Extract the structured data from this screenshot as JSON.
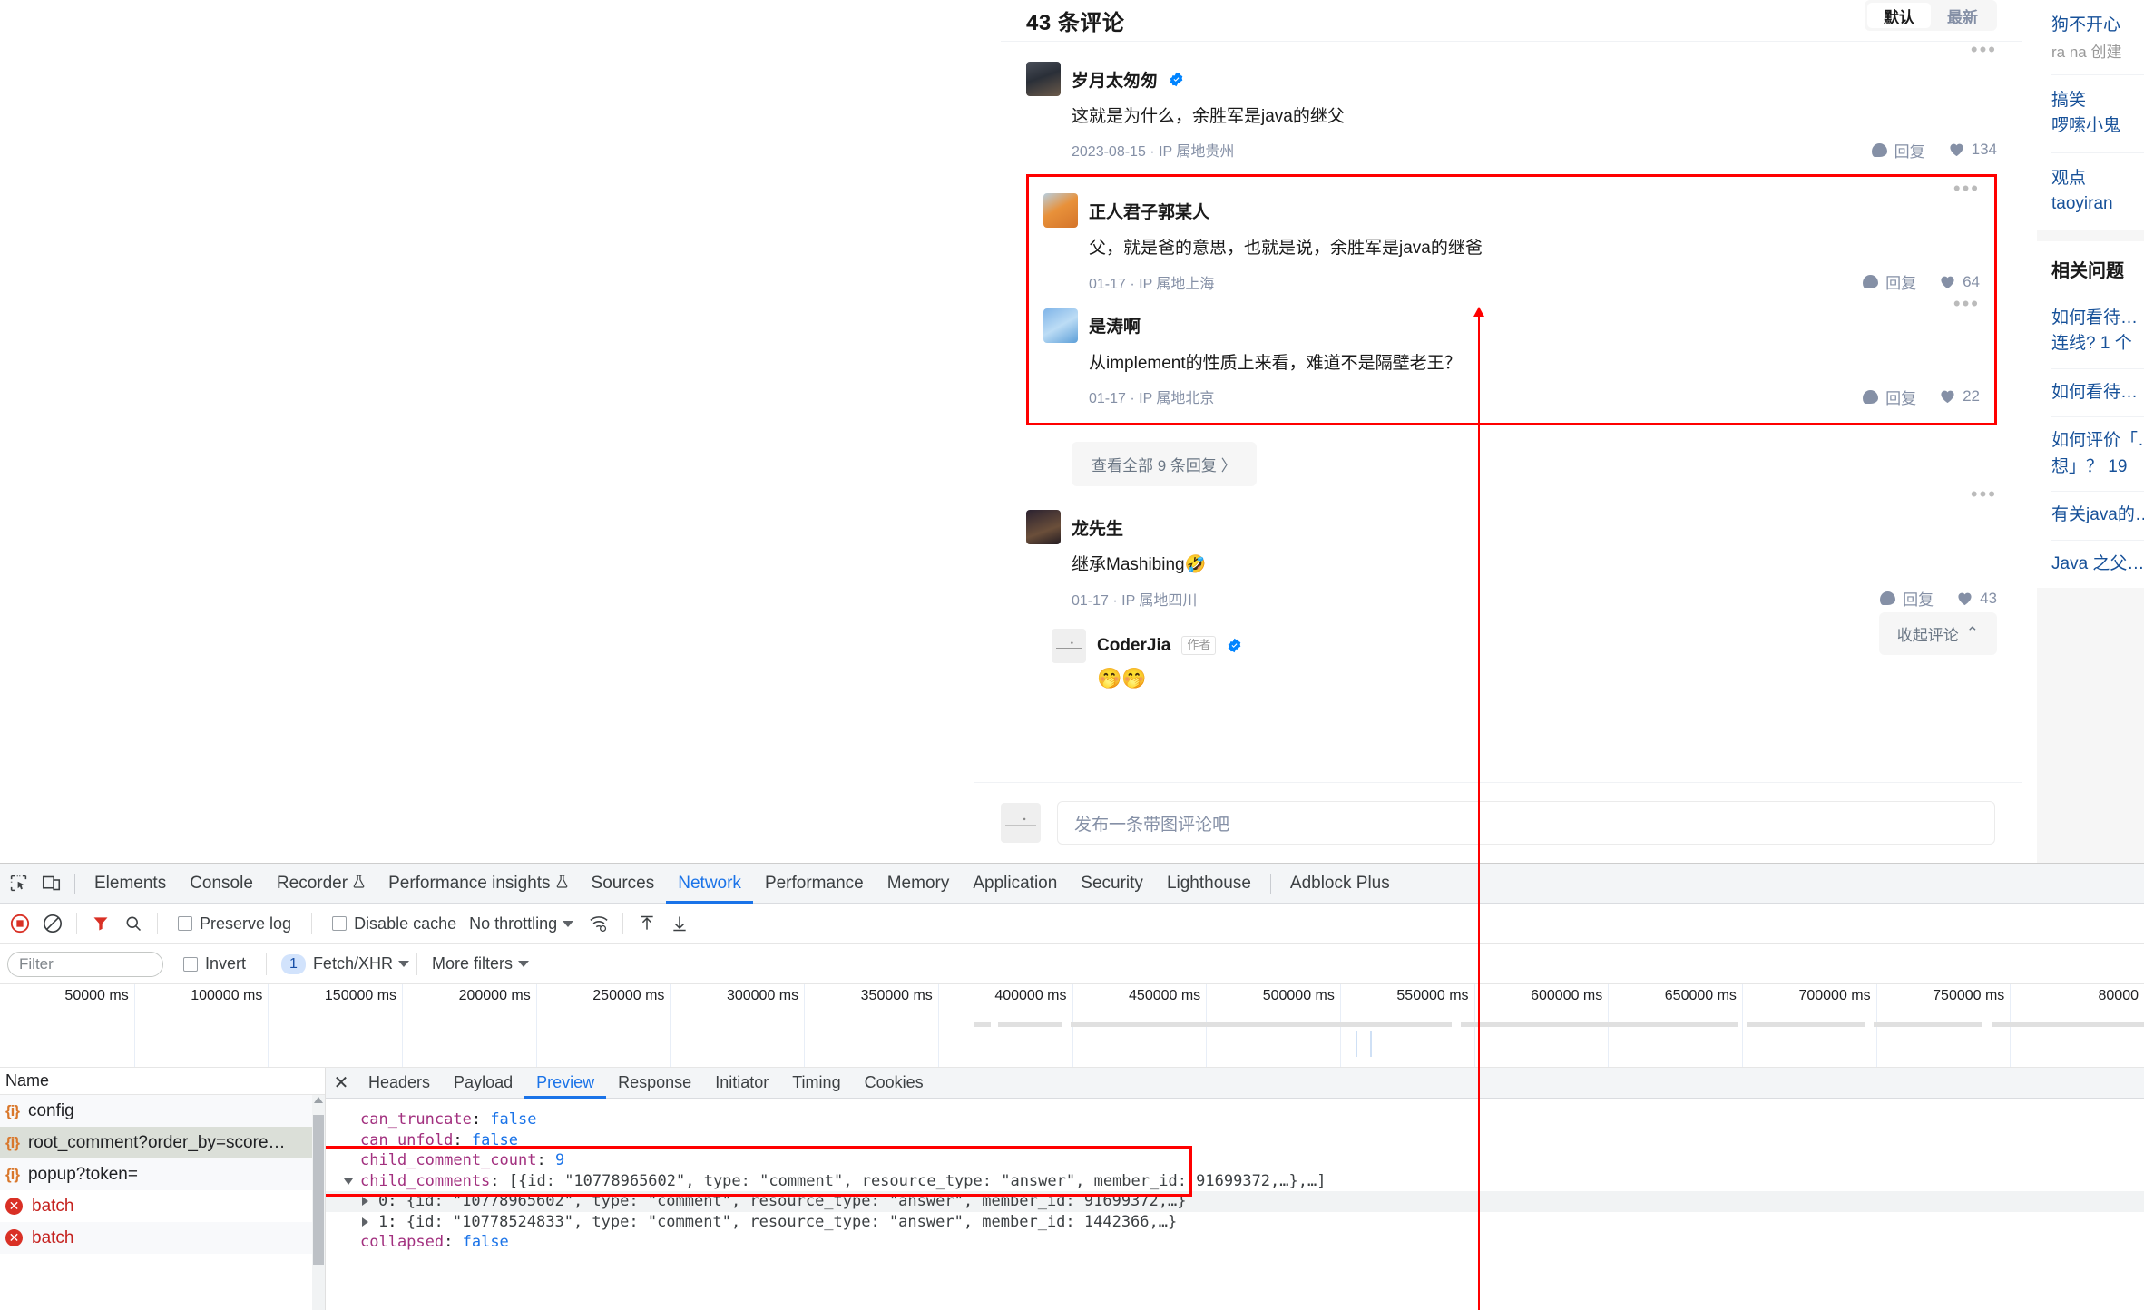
{
  "page": {
    "comment_count_label": "43 条评论",
    "sort": {
      "default_label": "默认",
      "latest_label": "最新"
    },
    "comments": [
      {
        "name": "岁月太匆匆",
        "verified": true,
        "text": "这就是为什么，余胜军是java的继父",
        "meta": "2023-08-15 · IP 属地贵州",
        "reply_label": "回复",
        "likes": "134"
      },
      {
        "name": "正人君子郭某人",
        "verified": false,
        "text": "父，就是爸的意思，也就是说，余胜军是java的继爸",
        "meta": "01-17 · IP 属地上海",
        "reply_label": "回复",
        "likes": "64"
      },
      {
        "name": "是涛啊",
        "verified": false,
        "text": "从implement的性质上来看，难道不是隔壁老王？",
        "meta": "01-17 · IP 属地北京",
        "reply_label": "回复",
        "likes": "22"
      },
      {
        "name": "龙先生",
        "verified": false,
        "text": "继承Mashibing🤣",
        "meta": "01-17 · IP 属地四川",
        "reply_label": "回复",
        "likes": "43"
      }
    ],
    "view_all_replies": "查看全部 9 条回复 〉",
    "author_comment": {
      "name": "CoderJia",
      "author_tag": "作者",
      "verified": true,
      "text": "🤭🤭"
    },
    "collapse_label": "收起评论",
    "composer_placeholder": "发布一条带图评论吧"
  },
  "right_rail": {
    "items": [
      {
        "title": "狗不开心",
        "sub": "ra na 创建"
      },
      {
        "title": "搞笑",
        "sub": "啰嗦小鬼"
      },
      {
        "title": "观点",
        "sub": "taoyiran"
      }
    ],
    "related_title": "相关问题",
    "related": [
      "如何看待…",
      "连线? 1 个",
      "如何看待…",
      "如何评价「…",
      "想」？ 19",
      "有关java的…",
      "Java 之父…"
    ]
  },
  "devtools": {
    "tabs": [
      {
        "label": "Elements",
        "active": false
      },
      {
        "label": "Console",
        "active": false
      },
      {
        "label": "Recorder",
        "active": false,
        "flask": true
      },
      {
        "label": "Performance insights",
        "active": false,
        "flask": true
      },
      {
        "label": "Sources",
        "active": false
      },
      {
        "label": "Network",
        "active": true
      },
      {
        "label": "Performance",
        "active": false
      },
      {
        "label": "Memory",
        "active": false
      },
      {
        "label": "Application",
        "active": false
      },
      {
        "label": "Security",
        "active": false
      },
      {
        "label": "Lighthouse",
        "active": false
      },
      {
        "label": "Adblock Plus",
        "active": false
      }
    ],
    "toolbar": {
      "preserve_log": "Preserve log",
      "disable_cache": "Disable cache",
      "throttling": "No throttling"
    },
    "filterbar": {
      "filter_placeholder": "Filter",
      "invert": "Invert",
      "fetch_xhr_count": "1",
      "fetch_xhr": "Fetch/XHR",
      "more_filters": "More filters"
    },
    "timeline_ticks": [
      "50000 ms",
      "100000 ms",
      "150000 ms",
      "200000 ms",
      "250000 ms",
      "300000 ms",
      "350000 ms",
      "400000 ms",
      "450000 ms",
      "500000 ms",
      "550000 ms",
      "600000 ms",
      "650000 ms",
      "700000 ms",
      "750000 ms",
      "80000"
    ],
    "request_list": {
      "column_name": "Name",
      "rows": [
        {
          "name": "config",
          "icon": "json-icon",
          "state": "normal"
        },
        {
          "name": "root_comment?order_by=score…",
          "icon": "json-icon",
          "state": "selected"
        },
        {
          "name": "popup?token=",
          "icon": "json-icon",
          "state": "normal"
        },
        {
          "name": "batch",
          "icon": "error-icon",
          "state": "error"
        },
        {
          "name": "batch",
          "icon": "error-icon",
          "state": "error"
        }
      ]
    },
    "detail_tabs": [
      {
        "label": "Headers",
        "active": false
      },
      {
        "label": "Payload",
        "active": false
      },
      {
        "label": "Preview",
        "active": true
      },
      {
        "label": "Response",
        "active": false
      },
      {
        "label": "Initiator",
        "active": false
      },
      {
        "label": "Timing",
        "active": false
      },
      {
        "label": "Cookies",
        "active": false
      }
    ],
    "preview_rows": [
      {
        "key": "can_truncate",
        "value": "false",
        "kind": "bool",
        "indent": 0
      },
      {
        "key": "can_unfold",
        "value": "false",
        "kind": "bool",
        "indent": 0
      },
      {
        "key": "child_comment_count",
        "value": "9",
        "kind": "num",
        "indent": 0
      },
      {
        "key": "child_comments",
        "value": "[{id: \"10778965602\", type: \"comment\", resource_type: \"answer\", member_id: 91699372,…},…]",
        "kind": "str",
        "indent": 0,
        "expandable": true,
        "expanded": true
      },
      {
        "key": "0",
        "value": "{id: \"10778965602\", type: \"comment\", resource_type: \"answer\", member_id: 91699372,…}",
        "kind": "str",
        "indent": 1,
        "expandable": true,
        "expanded": false
      },
      {
        "key": "1",
        "value": "{id: \"10778524833\", type: \"comment\", resource_type: \"answer\", member_id: 1442366,…}",
        "kind": "str",
        "indent": 1,
        "expandable": true,
        "expanded": false
      },
      {
        "key": "collapsed",
        "value": "false",
        "kind": "bool",
        "indent": 0
      }
    ]
  },
  "colors": {
    "accent": "#1a73e8",
    "annotation": "#ff0000",
    "link": "#175199",
    "muted": "#8590a6",
    "error": "#d93025"
  }
}
